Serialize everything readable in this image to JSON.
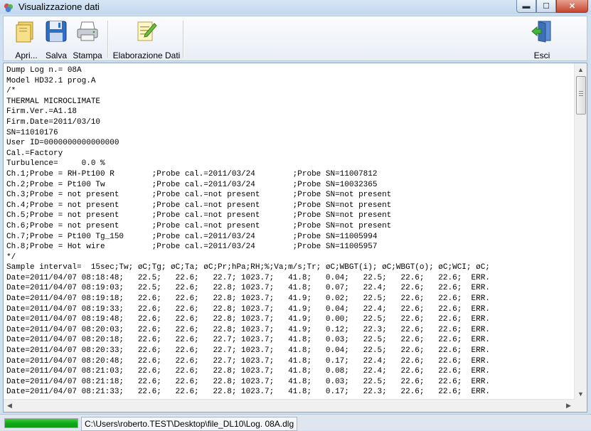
{
  "window": {
    "title": "Visualizzazione dati"
  },
  "window_buttons": {
    "minimize": "▬",
    "maximize": "☐",
    "close": "✕"
  },
  "toolbar": {
    "open_label": "Apri...",
    "save_label": "Salva",
    "print_label": "Stampa",
    "process_label": "Elaborazione Dati",
    "exit_label": "Esci"
  },
  "editor": {
    "lines": [
      "Dump Log n.= 08A",
      "Model HD32.1 prog.A",
      "/*",
      "THERMAL MICROCLIMATE",
      "Firm.Ver.=A1.18",
      "Firm.Date=2011/03/10",
      "SN=11010176",
      "User ID=0000000000000000",
      "Cal.=Factory",
      "Turbulence=     0.0 %",
      "Ch.1;Probe = RH-Pt100 R        ;Probe cal.=2011/03/24        ;Probe SN=11007812",
      "Ch.2;Probe = Pt100 Tw          ;Probe cal.=2011/03/24        ;Probe SN=10032365",
      "Ch.3;Probe = not present       ;Probe cal.=not present       ;Probe SN=not present",
      "Ch.4;Probe = not present       ;Probe cal.=not present       ;Probe SN=not present",
      "Ch.5;Probe = not present       ;Probe cal.=not present       ;Probe SN=not present",
      "Ch.6;Probe = not present       ;Probe cal.=not present       ;Probe SN=not present",
      "Ch.7;Probe = Pt100 Tg_150      ;Probe cal.=2011/03/24        ;Probe SN=11005994",
      "Ch.8;Probe = Hot wire          ;Probe cal.=2011/03/24        ;Probe SN=11005957",
      "*/",
      "Sample interval=  15sec;Tw; øC;Tg; øC;Ta; øC;Pr;hPa;RH;%;Va;m/s;Tr; øC;WBGT(i); øC;WBGT(o); øC;WCI; øC;",
      "Date=2011/04/07 08:18:48;   22.5;   22.6;   22.7; 1023.7;   41.8;   0.04;   22.5;   22.6;   22.6;  ERR.",
      "Date=2011/04/07 08:19:03;   22.5;   22.6;   22.8; 1023.7;   41.8;   0.07;   22.4;   22.6;   22.6;  ERR.",
      "Date=2011/04/07 08:19:18;   22.6;   22.6;   22.8; 1023.7;   41.9;   0.02;   22.5;   22.6;   22.6;  ERR.",
      "Date=2011/04/07 08:19:33;   22.6;   22.6;   22.8; 1023.7;   41.9;   0.04;   22.4;   22.6;   22.6;  ERR.",
      "Date=2011/04/07 08:19:48;   22.6;   22.6;   22.8; 1023.7;   41.9;   0.00;   22.5;   22.6;   22.6;  ERR.",
      "Date=2011/04/07 08:20:03;   22.6;   22.6;   22.8; 1023.7;   41.9;   0.12;   22.3;   22.6;   22.6;  ERR.",
      "Date=2011/04/07 08:20:18;   22.6;   22.6;   22.7; 1023.7;   41.8;   0.03;   22.5;   22.6;   22.6;  ERR.",
      "Date=2011/04/07 08:20:33;   22.6;   22.6;   22.7; 1023.7;   41.8;   0.04;   22.5;   22.6;   22.6;  ERR.",
      "Date=2011/04/07 08:20:48;   22.6;   22.6;   22.7; 1023.7;   41.8;   0.17;   22.4;   22.6;   22.6;  ERR.",
      "Date=2011/04/07 08:21:03;   22.6;   22.6;   22.8; 1023.7;   41.8;   0.08;   22.4;   22.6;   22.6;  ERR.",
      "Date=2011/04/07 08:21:18;   22.6;   22.6;   22.8; 1023.7;   41.8;   0.03;   22.5;   22.6;   22.6;  ERR.",
      "Date=2011/04/07 08:21:33;   22.6;   22.6;   22.8; 1023.7;   41.8;   0.17;   22.3;   22.6;   22.6;  ERR."
    ]
  },
  "scrollbars": {
    "up": "▲",
    "down": "▼",
    "left": "◀",
    "right": "▶"
  },
  "statusbar": {
    "progress_fraction": 1.0,
    "progress_color": "#11a818",
    "file_path": "C:\\Users\\roberto.TEST\\Desktop\\file_DL10\\Log. 08A.dlg"
  }
}
